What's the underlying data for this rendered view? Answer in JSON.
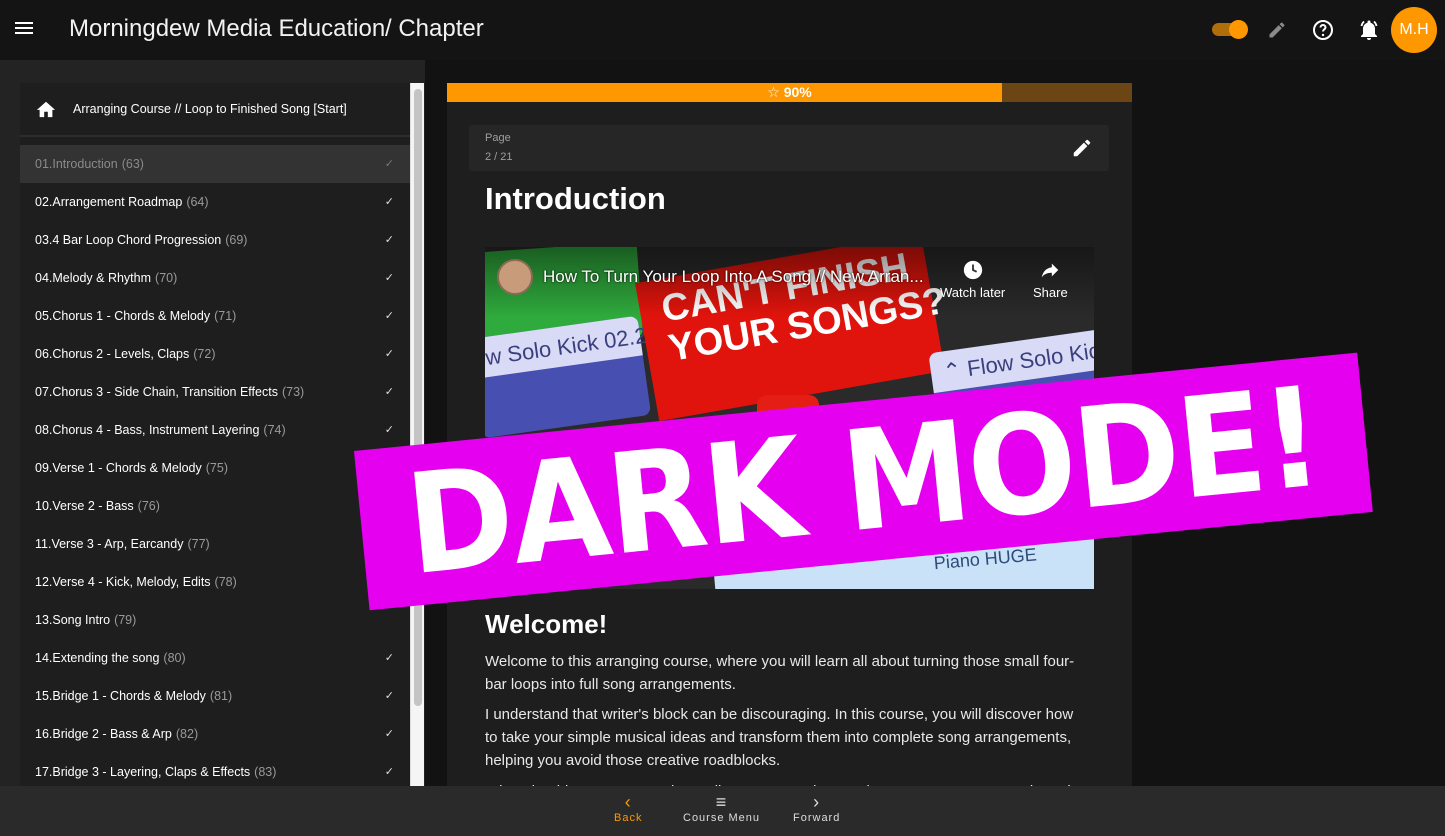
{
  "header": {
    "app_title": "Morningdew Media Education",
    "breadcrumb": "/ Chapter",
    "avatar_initials": "M.H",
    "icons": [
      "menu-icon",
      "dark-mode-toggle",
      "pencil-icon",
      "help-icon",
      "bell-icon"
    ]
  },
  "colors": {
    "accent": "#ff9800",
    "background": "#121212",
    "panel": "#1e1e1e",
    "banner": "#e600f0"
  },
  "sidebar": {
    "course_title": "Arranging Course // Loop to Finished Song [Start]",
    "chapters": [
      {
        "name": "01.Introduction",
        "count": "(63)",
        "completed": true,
        "active": true
      },
      {
        "name": "02.Arrangement Roadmap",
        "count": "(64)",
        "completed": true
      },
      {
        "name": "03.4 Bar Loop Chord Progression",
        "count": "(69)",
        "completed": true
      },
      {
        "name": "04.Melody & Rhythm",
        "count": "(70)",
        "completed": true
      },
      {
        "name": "05.Chorus 1 - Chords & Melody",
        "count": "(71)",
        "completed": true
      },
      {
        "name": "06.Chorus 2 - Levels, Claps",
        "count": "(72)",
        "completed": true
      },
      {
        "name": "07.Chorus 3 - Side Chain, Transition Effects",
        "count": "(73)",
        "completed": true
      },
      {
        "name": "08.Chorus 4 - Bass, Instrument Layering",
        "count": "(74)",
        "completed": true
      },
      {
        "name": "09.Verse 1 - Chords & Melody",
        "count": "(75)",
        "completed": false
      },
      {
        "name": "10.Verse 2 - Bass",
        "count": "(76)",
        "completed": false
      },
      {
        "name": "11.Verse 3 - Arp, Earcandy",
        "count": "(77)",
        "completed": false
      },
      {
        "name": "12.Verse 4 - Kick, Melody, Edits",
        "count": "(78)",
        "completed": false
      },
      {
        "name": "13.Song Intro",
        "count": "(79)",
        "completed": false
      },
      {
        "name": "14.Extending the song",
        "count": "(80)",
        "completed": true
      },
      {
        "name": "15.Bridge 1 - Chords & Melody",
        "count": "(81)",
        "completed": true
      },
      {
        "name": "16.Bridge 2 - Bass & Arp",
        "count": "(82)",
        "completed": true
      },
      {
        "name": "17.Bridge 3 - Layering, Claps & Effects",
        "count": "(83)",
        "completed": true
      }
    ],
    "check_glyph": "✓"
  },
  "content": {
    "progress_percent": 90,
    "progress_label": "☆ 90%",
    "page_label": "Page",
    "page_value": "2 / 21",
    "title": "Introduction",
    "video": {
      "title": "How To Turn Your Loop Into A Song // New Arran...",
      "watch_later": "Watch later",
      "share": "Share",
      "thumb_kick_left": "w Solo Kick 02.2",
      "thumb_headline": "CAN'T FINISH\nYOUR SONGS?",
      "thumb_kick_right": "⌃ Flow Solo Kic",
      "thumb_bottom": "Piano HUGE"
    },
    "section_heading": "Welcome!",
    "paragraphs": [
      "Welcome to this arranging course, where you will learn all about turning those small four-bar loops into full song arrangements.",
      "I understand that writer's block can be discouraging. In this course, you will discover how to take your simple musical ideas and transform them into complete song arrangements, helping you avoid those creative roadblocks.",
      "What should you expect and? You'll go on a step-by-step journey to arrange a track, and..."
    ]
  },
  "bottom_nav": {
    "back": "Back",
    "menu": "Course Menu",
    "forward": "Forward"
  },
  "banner": {
    "text": "DARK MODE!"
  }
}
